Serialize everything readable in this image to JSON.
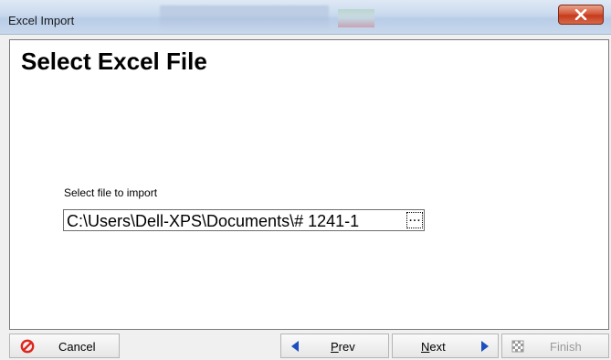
{
  "window": {
    "title": "Excel Import"
  },
  "page": {
    "heading": "Select Excel File"
  },
  "file_picker": {
    "label": "Select file to import",
    "value": "C:\\Users\\Dell-XPS\\Documents\\# 1241-1",
    "browse_label": "..."
  },
  "buttons": {
    "cancel": {
      "label": "Cancel",
      "icon": "cancel-icon",
      "color": "#e0231b"
    },
    "prev": {
      "accel": "P",
      "rest": "rev",
      "icon": "arrow-left-icon",
      "color": "#1f4fbf"
    },
    "next": {
      "accel": "N",
      "rest": "ext",
      "icon": "arrow-right-icon",
      "color": "#1f4fbf"
    },
    "finish": {
      "label": "Finish",
      "icon": "checkered-flag-icon",
      "enabled": false
    }
  }
}
